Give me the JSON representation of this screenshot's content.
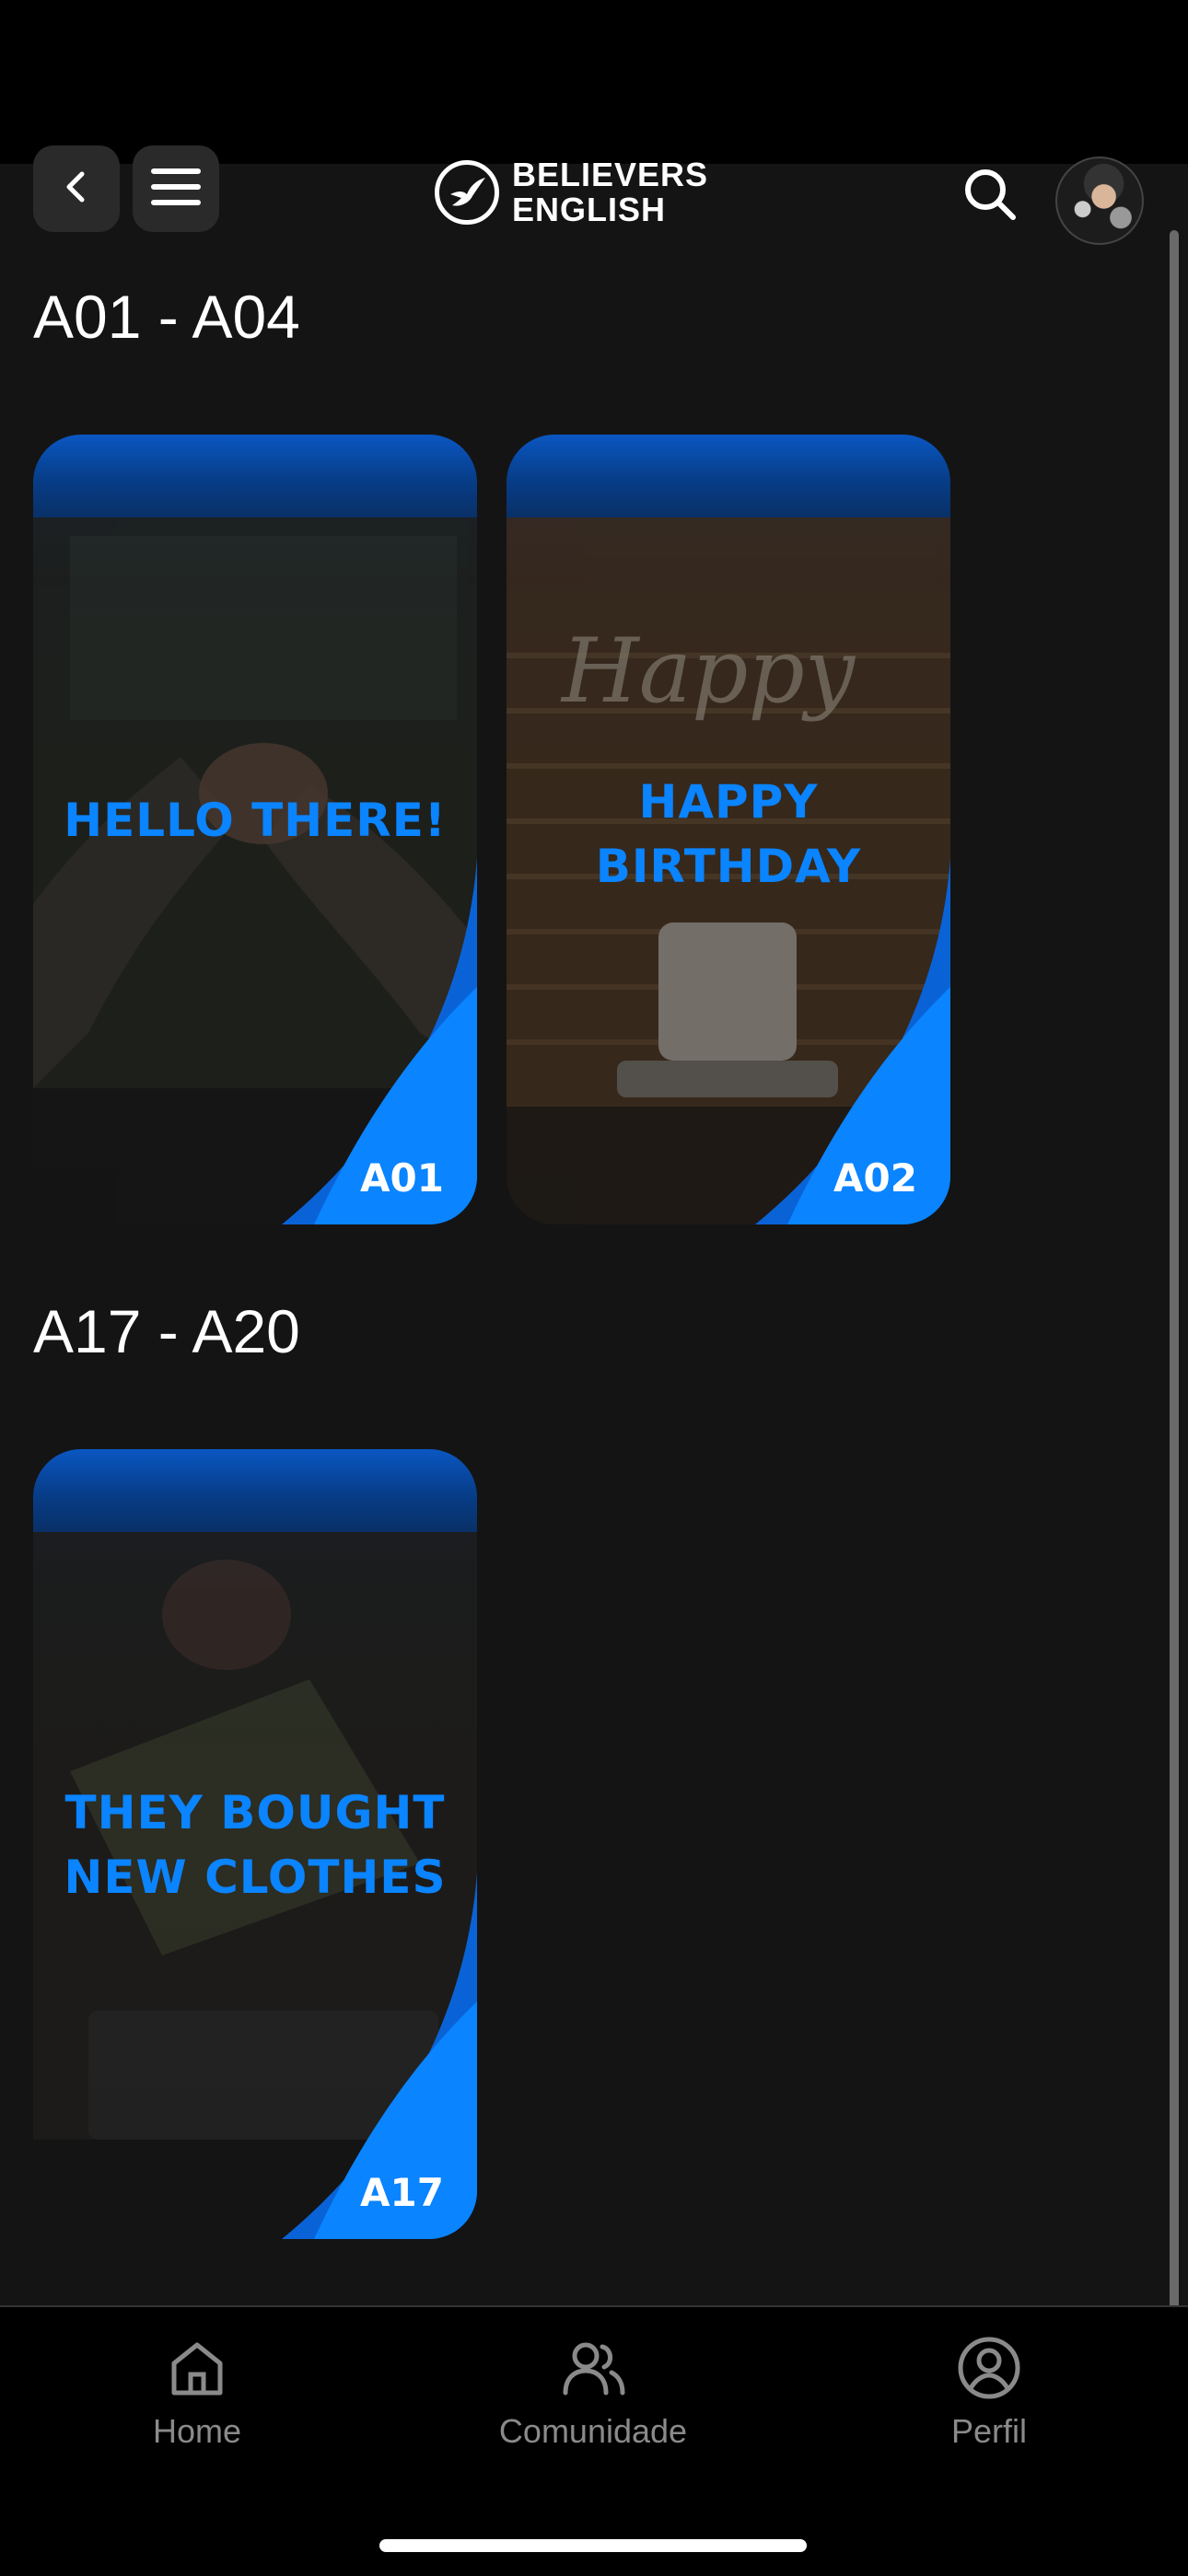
{
  "header": {
    "back_icon": "chevron-left-icon",
    "menu_icon": "hamburger-menu-icon",
    "logo_line1": "BELIEVERS",
    "logo_line2": "ENGLISH",
    "search_icon": "search-icon",
    "avatar_icon": "user-avatar"
  },
  "sections": [
    {
      "title": "A01 - A04",
      "cards": [
        {
          "caption_lines": [
            "HELLO THERE!"
          ],
          "code": "A01"
        },
        {
          "caption_lines": [
            "HAPPY",
            "BIRTHDAY"
          ],
          "code": "A02"
        }
      ]
    },
    {
      "title": "A17 - A20",
      "cards": [
        {
          "caption_lines": [
            "THEY BOUGHT",
            "NEW CLOTHES"
          ],
          "code": "A17"
        }
      ]
    }
  ],
  "tabbar": {
    "items": [
      {
        "label": "Home",
        "icon": "home-icon"
      },
      {
        "label": "Comunidade",
        "icon": "community-icon"
      },
      {
        "label": "Perfil",
        "icon": "profile-icon"
      }
    ]
  },
  "colors": {
    "accent": "#0a84ff",
    "background": "#141414",
    "tabbar": "#000000"
  }
}
